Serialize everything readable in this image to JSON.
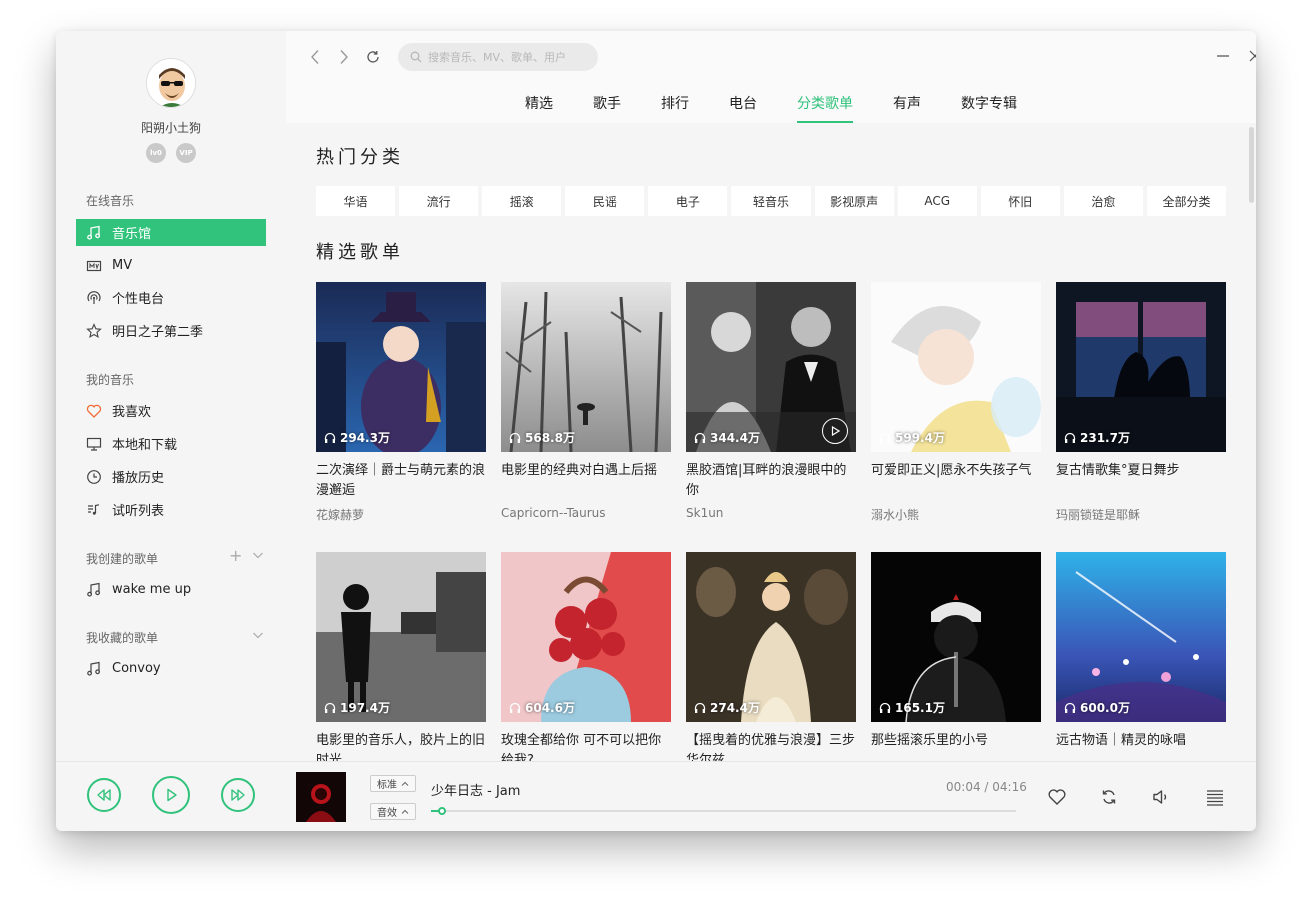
{
  "user": {
    "name": "阳朔小土狗",
    "badges": [
      "lv0",
      "vip"
    ]
  },
  "sidebar": {
    "online_header": "在线音乐",
    "online_items": [
      {
        "label": "音乐馆",
        "icon": "music-note-icon",
        "active": true
      },
      {
        "label": "MV",
        "icon": "mv-icon",
        "active": false
      },
      {
        "label": "个性电台",
        "icon": "radio-icon",
        "active": false
      },
      {
        "label": "明日之子第二季",
        "icon": "star-icon",
        "active": false
      }
    ],
    "mine_header": "我的音乐",
    "mine_items": [
      {
        "label": "我喜欢",
        "icon": "heart-icon"
      },
      {
        "label": "本地和下载",
        "icon": "monitor-icon"
      },
      {
        "label": "播放历史",
        "icon": "clock-icon"
      },
      {
        "label": "试听列表",
        "icon": "playlist-icon"
      }
    ],
    "created_header": "我创建的歌单",
    "created_items": [
      {
        "label": "wake me up",
        "icon": "music-note-icon"
      }
    ],
    "collected_header": "我收藏的歌单",
    "collected_items": [
      {
        "label": "Convoy",
        "icon": "music-note-icon"
      }
    ]
  },
  "search": {
    "placeholder": "搜索音乐、MV、歌单、用户"
  },
  "tabs": [
    {
      "label": "精选",
      "active": false
    },
    {
      "label": "歌手",
      "active": false
    },
    {
      "label": "排行",
      "active": false
    },
    {
      "label": "电台",
      "active": false
    },
    {
      "label": "分类歌单",
      "active": true
    },
    {
      "label": "有声",
      "active": false
    },
    {
      "label": "数字专辑",
      "active": false
    }
  ],
  "hot_categories": {
    "title": "热门分类",
    "items": [
      "华语",
      "流行",
      "摇滚",
      "民谣",
      "电子",
      "轻音乐",
      "影视原声",
      "ACG",
      "怀旧",
      "治愈",
      "全部分类"
    ]
  },
  "featured": {
    "title": "精选歌单",
    "playlists": [
      {
        "plays": "294.3万",
        "title": "二次演绎｜爵士与萌元素的浪漫邂逅",
        "author": "花嫁赫萝"
      },
      {
        "plays": "568.8万",
        "title": "电影里的经典对白遇上后摇",
        "author": "Capricorn--Taurus"
      },
      {
        "plays": "344.4万",
        "title": "黑胶酒馆|耳畔的浪漫眼中的你",
        "author": "Sk1un"
      },
      {
        "plays": "599.4万",
        "title": "可爱即正义|愿永不失孩子气",
        "author": "溺水小熊"
      },
      {
        "plays": "231.7万",
        "title": "复古情歌集°夏日舞步",
        "author": "玛丽锁链是耶稣"
      },
      {
        "plays": "197.4万",
        "title": "电影里的音乐人，胶片上的旧时光",
        "author": ""
      },
      {
        "plays": "604.6万",
        "title": "玫瑰全都给你 可不可以把你给我?",
        "author": ""
      },
      {
        "plays": "274.4万",
        "title": "【摇曳着的优雅与浪漫】三步华尔兹",
        "author": ""
      },
      {
        "plays": "165.1万",
        "title": "那些摇滚乐里的小号",
        "author": ""
      },
      {
        "plays": "600.0万",
        "title": "远古物语｜精灵的咏唱",
        "author": ""
      }
    ]
  },
  "player": {
    "song": "少年日志 - Jam",
    "current_time": "00:04",
    "total_time": "04:16",
    "time_display": "00:04 / 04:16",
    "quality_label": "标准",
    "effect_label": "音效",
    "progress": 0.016,
    "colors": {
      "accent": "#31c27c"
    }
  }
}
